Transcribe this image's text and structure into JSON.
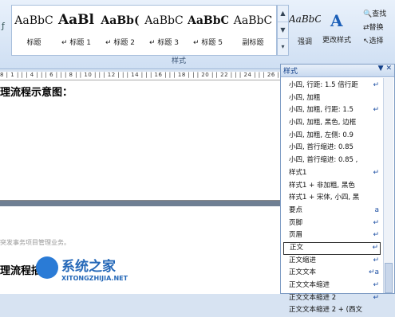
{
  "ribbon": {
    "left_glyph": "ƒ",
    "gallery": [
      {
        "sample": "AaBbC",
        "name": "标题"
      },
      {
        "sample": "AaBl",
        "name": "↵ 标题 1"
      },
      {
        "sample": "AaBb(",
        "name": "↵ 标题 2"
      },
      {
        "sample": "AaBbC",
        "name": "↵ 标题 3"
      },
      {
        "sample": "AaBbC",
        "name": "↵ 标题 5"
      },
      {
        "sample": "AaBbC",
        "name": "副标题"
      },
      {
        "sample": "AaBbCc",
        "name": "强调"
      }
    ],
    "change_styles_label": "更改样式",
    "group_label": "样式",
    "editing": [
      {
        "icon": "find-icon",
        "label": "查找"
      },
      {
        "icon": "replace-icon",
        "label": "替换"
      },
      {
        "icon": "select-icon",
        "label": "选择"
      }
    ]
  },
  "ruler": {
    "ticks": "8 | 1 | | | 4 | | | 6 | | | 8 | | 10 | | | 12 | | | 14 | | | 16 | | | 18 | | | 20 | | 22 | | | 24 | | | 26 |"
  },
  "document": {
    "heading_top": "理流程示意图：",
    "faint_line": "突发事务项目管理业务。",
    "heading_bottom": "理流程描述："
  },
  "watermark": {
    "title": "系统之家",
    "url": "XITONGZHIJIA.NET"
  },
  "styles_pane": {
    "title": "样式",
    "controls": "▼ ✕",
    "items": [
      {
        "label": "小四, 行距: 1.5 倍行距",
        "mark": "↵",
        "selected": false
      },
      {
        "label": "小四, 加粗",
        "mark": "",
        "selected": false
      },
      {
        "label": "小四, 加粗, 行距: 1.5",
        "mark": "↵",
        "selected": false
      },
      {
        "label": "小四, 加粗, 黑色, 边框",
        "mark": "",
        "selected": false
      },
      {
        "label": "小四, 加粗, 左侧: 0.9",
        "mark": "",
        "selected": false
      },
      {
        "label": "小四, 首行缩进: 0.85",
        "mark": "",
        "selected": false
      },
      {
        "label": "小四, 首行缩进: 0.85 ,",
        "mark": "",
        "selected": false
      },
      {
        "label": "样式1",
        "mark": "↵",
        "selected": false
      },
      {
        "label": "样式1 + 非加粗, 黑色",
        "mark": "",
        "selected": false
      },
      {
        "label": "样式1 + 宋体, 小四, 黑",
        "mark": "",
        "selected": false
      },
      {
        "label": "要点",
        "mark": "a",
        "selected": false
      },
      {
        "label": "页脚",
        "mark": "↵",
        "selected": false
      },
      {
        "label": "页眉",
        "mark": "↵",
        "selected": false
      },
      {
        "label": "正文",
        "mark": "↵",
        "selected": true
      },
      {
        "label": "正文缩进",
        "mark": "↵",
        "selected": false
      },
      {
        "label": "正文文本",
        "mark": "↵a",
        "selected": false
      },
      {
        "label": "正文文本缩进",
        "mark": "↵",
        "selected": false
      },
      {
        "label": "正文文本缩进 2",
        "mark": "↵",
        "selected": false
      },
      {
        "label": "正文文本缩进 2 + (西文",
        "mark": "",
        "selected": false
      }
    ]
  }
}
